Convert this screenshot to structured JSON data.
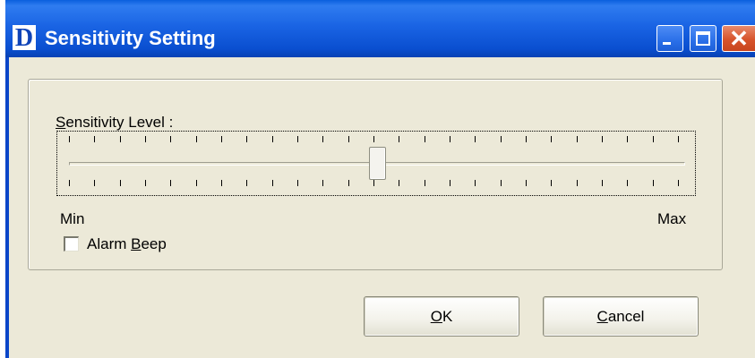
{
  "window": {
    "logo_letter": "D",
    "title": "Sensitivity Setting",
    "close_glyph": "✕"
  },
  "controls": {
    "sensitivity_label_first": "S",
    "sensitivity_label_rest": "ensitivity Level :",
    "slider_tick_count": 25,
    "slider_level": 0.5,
    "min_label": "Min",
    "max_label": "Max",
    "alarm_label_prefix": "Alarm ",
    "alarm_label_mnemonic": "B",
    "alarm_label_suffix": "eep",
    "alarm_checked": false
  },
  "buttons": {
    "ok_mnemonic": "O",
    "ok_rest": "K",
    "cancel_mnemonic": "C",
    "cancel_rest": "ancel"
  },
  "colors": {
    "titlebar": "#0a4fd0",
    "dialog_face": "#ece9d8",
    "close_button": "#d7532b"
  },
  "icons": {
    "app": "d-logo-icon",
    "minimize": "minimize-icon",
    "maximize": "maximize-icon",
    "close": "close-icon"
  }
}
